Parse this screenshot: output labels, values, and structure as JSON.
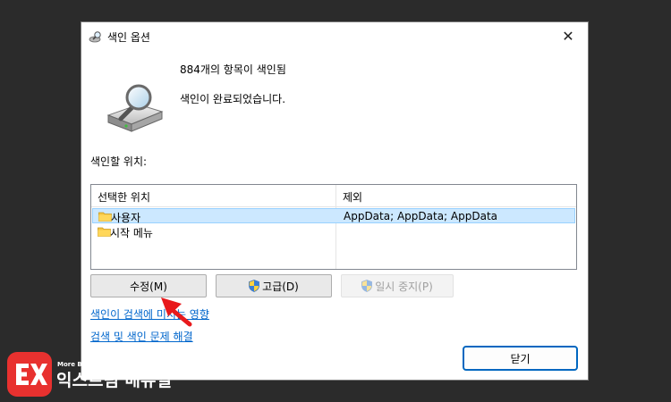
{
  "dialog": {
    "title": "색인 옵션",
    "close_glyph": "✕",
    "status_items": "884개의 항목이 색인됨",
    "status_complete": "색인이 완료되었습니다.",
    "locations_label": "색인할 위치:",
    "table": {
      "col_location": "선택한 위치",
      "col_exclude": "제외",
      "rows": [
        {
          "name": "사용자",
          "exclude": "AppData; AppData; AppData",
          "selected": true
        },
        {
          "name": "시작 메뉴",
          "exclude": "",
          "selected": false
        }
      ]
    },
    "buttons": {
      "modify": "수정(M)",
      "advanced": "고급(D)",
      "pause": "일시 중지(P)",
      "close": "닫기"
    },
    "links": {
      "effects": "색인이 검색에 미치는 영향",
      "troubleshoot": "검색 및 색인 문제 해결"
    }
  },
  "watermark": {
    "tagline": "More Better IT Life",
    "brand": "익스트림 매뉴얼",
    "logo_color": "#e8312f"
  },
  "annotation_arrow_color": "#e8191c"
}
